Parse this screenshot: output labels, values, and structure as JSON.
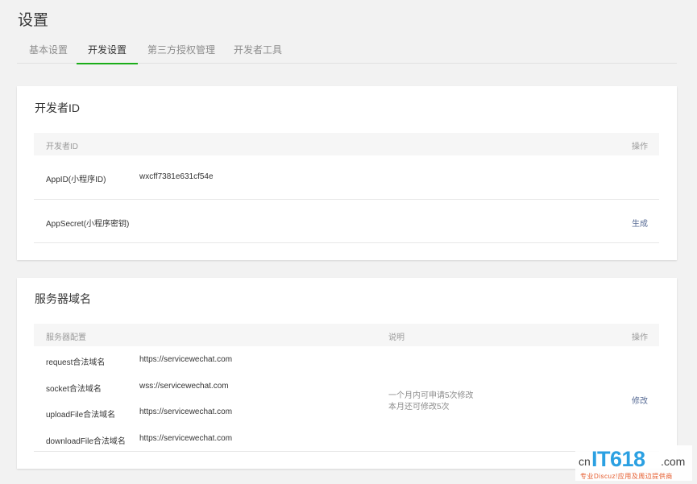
{
  "page": {
    "title": "设置"
  },
  "tabs": [
    {
      "label": "基本设置",
      "active": false
    },
    {
      "label": "开发设置",
      "active": true
    },
    {
      "label": "第三方授权管理",
      "active": false
    },
    {
      "label": "开发者工具",
      "active": false
    }
  ],
  "developer_id": {
    "title": "开发者ID",
    "header": {
      "col1": "开发者ID",
      "action": "操作"
    },
    "rows": [
      {
        "label": "AppID(小程序ID)",
        "value": "wxcff7381e631cf54e",
        "action": ""
      },
      {
        "label": "AppSecret(小程序密钥)",
        "value": "",
        "action": "生成"
      }
    ]
  },
  "server_domain": {
    "title": "服务器域名",
    "header": {
      "col1": "服务器配置",
      "col2": "说明",
      "action": "操作"
    },
    "rows": [
      {
        "label": "request合法域名",
        "value": "https://servicewechat.com"
      },
      {
        "label": "socket合法域名",
        "value": "wss://servicewechat.com"
      },
      {
        "label": "uploadFile合法域名",
        "value": "https://servicewechat.com"
      },
      {
        "label": "downloadFile合法域名",
        "value": "https://servicewechat.com"
      }
    ],
    "note_line1": "一个月内可申请5次修改",
    "note_line2": "本月还可修改5次",
    "action": "修改"
  },
  "watermark": {
    "cn": "cn",
    "it": "IT618",
    "com": ".com",
    "sub": "专业Discuz!应用及周边提供商"
  },
  "colors": {
    "accent": "#1aad19",
    "link": "#576b95",
    "background": "#f2f2f2"
  }
}
